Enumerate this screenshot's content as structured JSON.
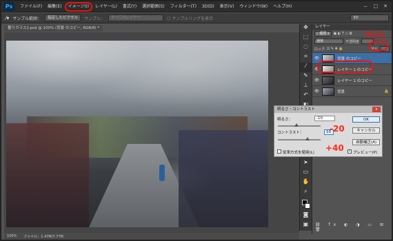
{
  "menubar": {
    "logo": "Ps",
    "items": [
      "ファイル(F)",
      "編集(E)",
      "イメージ(I)",
      "レイヤー(L)",
      "書式(Y)",
      "選択範囲(S)",
      "フィルター(T)",
      "3D(D)",
      "表示(V)",
      "ウィンドウ(W)",
      "ヘルプ(H)"
    ],
    "window_buttons": [
      "－",
      "□",
      "✕"
    ]
  },
  "options_bar": {
    "sample_label": "サンプル範囲：",
    "sample_value": "指定したピクセル",
    "sample2_label": "サンプル：",
    "sample2_value": "すべてのレイヤー",
    "ring_label": "サンプルリングを表示",
    "mode_value": "3D"
  },
  "document": {
    "tab": "曇りガラス2.psd @ 100% (背景 のコピー, RGB/8) *",
    "zoom": "100%",
    "file_info": "ファイル：1.47M/7.77M"
  },
  "layers_panel": {
    "tab": "レイヤー",
    "kind_label": "種類",
    "blend_mode": "通常",
    "opacity_label": "不透明度",
    "lock_label": "ロック",
    "fill_label": "塗り",
    "layers": [
      {
        "name": "背景 のコピー",
        "active": true
      },
      {
        "name": "レイヤー 1 のコピー",
        "active": false
      },
      {
        "name": "レイヤー 1 のコピー",
        "active": false
      },
      {
        "name": "背景",
        "active": false
      }
    ]
  },
  "annotations": {
    "opacity_value": "95%",
    "brightness_value": "-20",
    "contrast_value": "+40"
  },
  "dialog": {
    "title": "明るさ・コントラスト",
    "brightness_label": "明るさ：",
    "brightness_value": "-10",
    "contrast_label": "コントラスト：",
    "contrast_value": "10",
    "ok": "OK",
    "cancel": "キャンセル",
    "auto": "自動補正(A)",
    "preview": "プレビュー(P)",
    "legacy": "従来方式を使用(L)"
  }
}
